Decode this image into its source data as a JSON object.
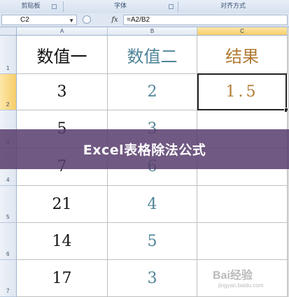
{
  "ribbon": {
    "groups": [
      {
        "label": "剪贴板"
      },
      {
        "label": "字体"
      },
      {
        "label": "对齐方式"
      }
    ]
  },
  "formula_bar": {
    "name_box": "C2",
    "fx_label": "fx",
    "formula": "=A2/B2"
  },
  "columns": [
    {
      "label": "A"
    },
    {
      "label": "B"
    },
    {
      "label": "C",
      "active": true
    }
  ],
  "rows": [
    {
      "num": "1",
      "a": "数值一",
      "b": "数值二",
      "c": "结果"
    },
    {
      "num": "2",
      "a": "3",
      "b": "2",
      "c": "1.5"
    },
    {
      "num": "3",
      "a": "5",
      "b": "3",
      "c": ""
    },
    {
      "num": "4",
      "a": "7",
      "b": "6",
      "c": ""
    },
    {
      "num": "5",
      "a": "21",
      "b": "4",
      "c": ""
    },
    {
      "num": "6",
      "a": "14",
      "b": "5",
      "c": ""
    },
    {
      "num": "7",
      "a": "17",
      "b": "3",
      "c": ""
    }
  ],
  "overlay": {
    "title": "Excel表格除法公式"
  },
  "watermark": {
    "logo_text": "Bai经验",
    "url": "jingyan.baidu.com"
  },
  "colors": {
    "column_a_text": "#111111",
    "column_b_text": "#4f8499",
    "column_c_text": "#b07a33",
    "active_header": "#f6cd6a",
    "overlay": "#583e6e"
  }
}
